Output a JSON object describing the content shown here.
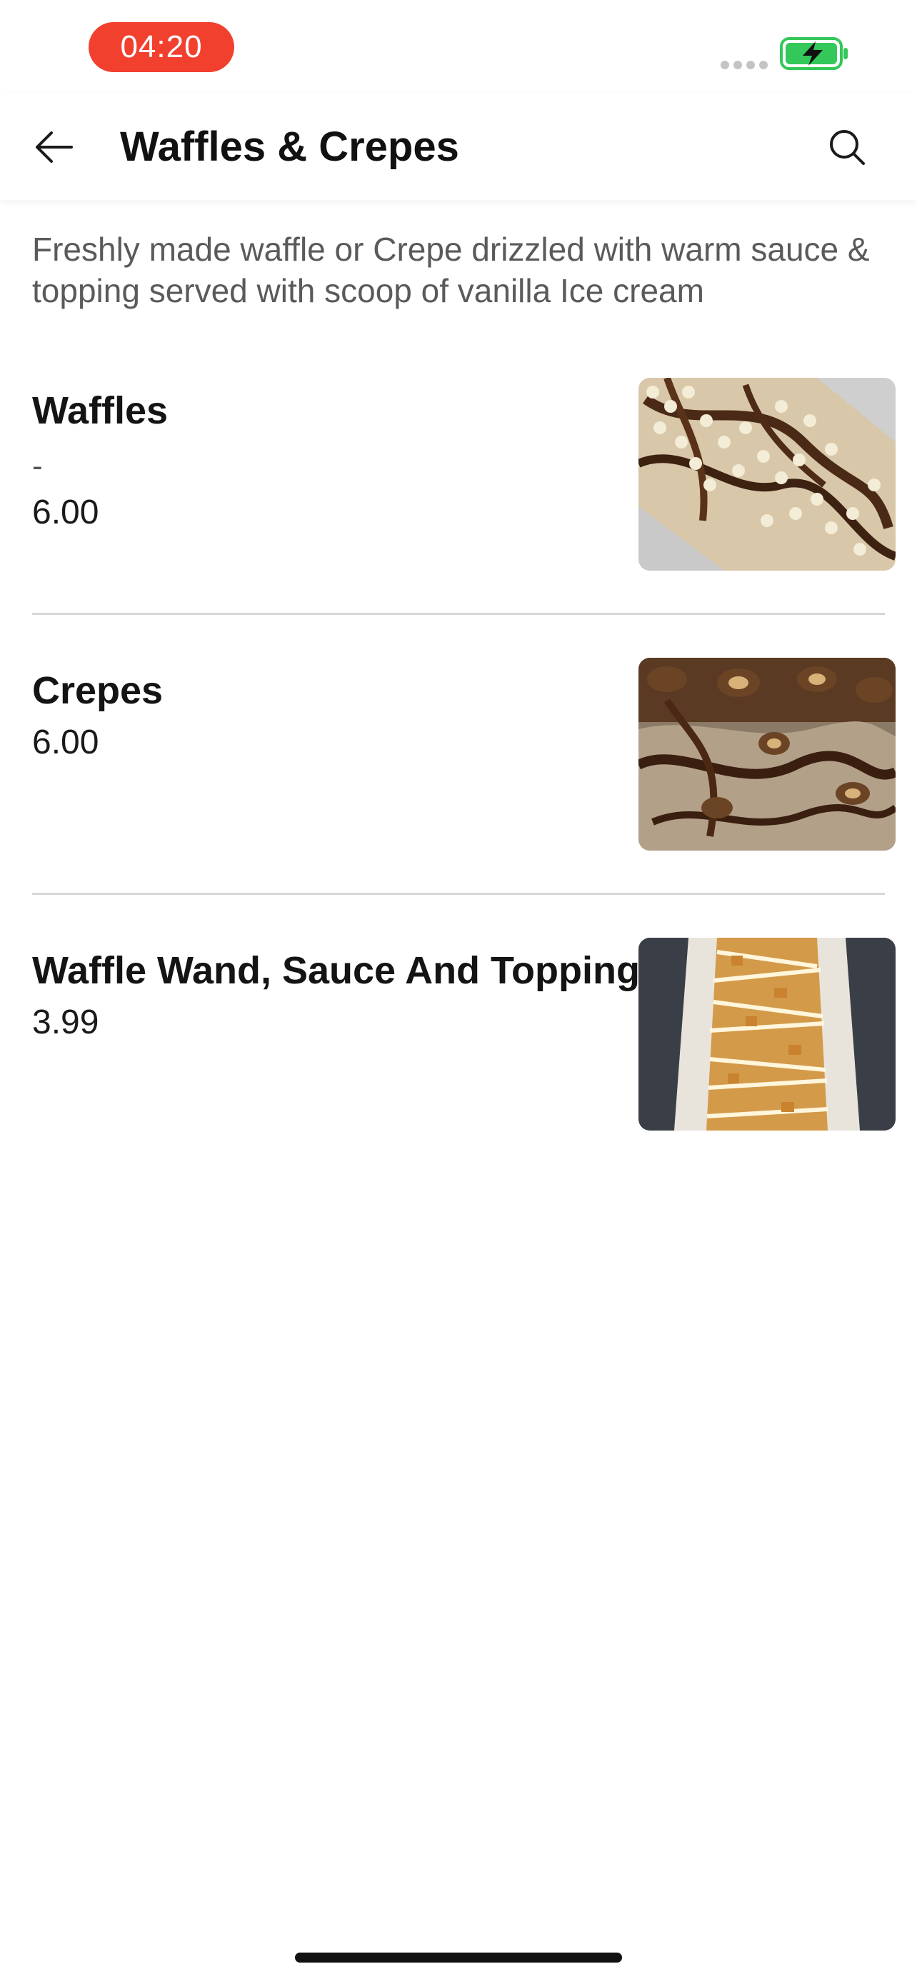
{
  "status_bar": {
    "time": "04:20",
    "time_pill_color": "#f2402f",
    "battery_color": "#34c759",
    "battery_state": "charging"
  },
  "header": {
    "title": "Waffles & Crepes",
    "back_icon": "arrow-left-icon",
    "search_icon": "search-icon"
  },
  "category": {
    "description": "Freshly made waffle or Crepe drizzled with warm sauce & topping served with scoop of vanilla Ice cream"
  },
  "menu_items": [
    {
      "name": "Waffles",
      "subtitle": "-",
      "price": "6.00",
      "photo": "waffle-photo"
    },
    {
      "name": "Crepes",
      "price": "6.00",
      "photo": "crepe-photo"
    },
    {
      "name": "Waffle Wand, Sauce And Topping",
      "price": "3.99",
      "photo": "waffle-wand-photo"
    }
  ]
}
